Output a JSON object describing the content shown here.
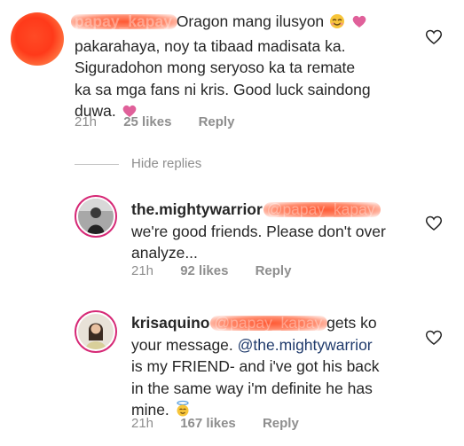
{
  "comments": [
    {
      "username_redacted": "papay_kapay",
      "text_lines": [
        "Oragon mang ilusyon",
        "pakarahaya, noy ta tibaad madisata ka.",
        "Siguradohon mong seryoso ka ta remate",
        "ka sa mga fans ni kris. Good luck saindong",
        "duwa."
      ],
      "time": "21h",
      "likes": "25 likes",
      "reply": "Reply"
    },
    {
      "username": "the.mightywarrior",
      "mention_redacted": "@papay_kapay",
      "text_lines": [
        "we're good friends. Please don't over",
        "analyze..."
      ],
      "time": "21h",
      "likes": "92 likes",
      "reply": "Reply"
    },
    {
      "username": "krisaquino",
      "mention_redacted": "@papay_kapay",
      "text_line1_suffix": "gets ko",
      "text_line2_prefix": "your message.",
      "text_line2_mention": "@the.mightywarrior",
      "text_lines_rest": [
        "is my FRIEND- and i've got his back",
        "in the same way i'm definite he has",
        "mine."
      ],
      "time": "21h",
      "likes": "167 likes",
      "reply": "Reply"
    }
  ],
  "hide_replies": "Hide replies",
  "icons": {
    "like": "heart-outline-icon",
    "emoji1": "smiling-face-with-heart-hands-emoji",
    "emoji2": "pink-heart-emoji",
    "emoji3": "angel-emoji"
  },
  "colors": {
    "text": "#262626",
    "meta": "#8e8e8e",
    "mention": "#1f3a6b",
    "heart_emoji": "#e0609a",
    "redaction": "#ff5a2e"
  }
}
